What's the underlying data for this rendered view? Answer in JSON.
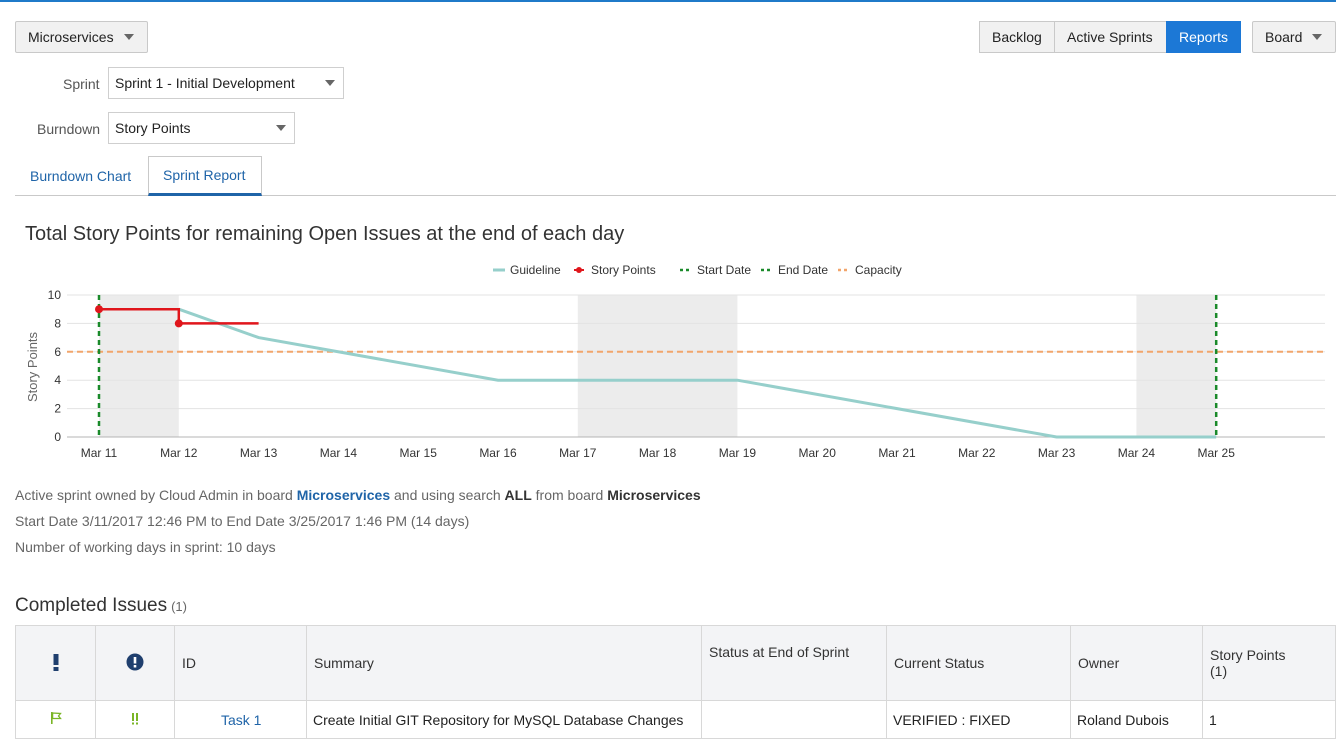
{
  "toolbar": {
    "board_selector": "Microservices",
    "nav": [
      "Backlog",
      "Active Sprints",
      "Reports"
    ],
    "board_menu": "Board"
  },
  "filters": {
    "sprint_label": "Sprint",
    "sprint_value": "Sprint 1 - Initial Development",
    "burndown_label": "Burndown",
    "burndown_value": "Story Points"
  },
  "tabs": [
    "Burndown Chart",
    "Sprint Report"
  ],
  "chart_data": {
    "type": "line",
    "title": "Total Story Points for remaining Open Issues at the end of each day",
    "ylabel": "Story Points",
    "xlabel": "",
    "ylim": [
      0,
      10
    ],
    "yticks": [
      "0",
      "2",
      "4",
      "6",
      "8",
      "10"
    ],
    "categories": [
      "Mar 11",
      "Mar 12",
      "Mar 13",
      "Mar 14",
      "Mar 15",
      "Mar 16",
      "Mar 17",
      "Mar 18",
      "Mar 19",
      "Mar 20",
      "Mar 21",
      "Mar 22",
      "Mar 23",
      "Mar 24",
      "Mar 25"
    ],
    "legend": [
      "Guideline",
      "Story Points",
      "Start Date",
      "End Date",
      "Capacity"
    ],
    "legend_position": "top",
    "grid": true,
    "non_working_ranges": [
      [
        "Mar 11",
        "Mar 12"
      ],
      [
        "Mar 17",
        "Mar 19"
      ],
      [
        "Mar 24",
        "Mar 25"
      ]
    ],
    "series": [
      {
        "name": "Guideline",
        "color": "#96cfcb",
        "x": [
          "Mar 12",
          "Mar 13",
          "Mar 16",
          "Mar 19",
          "Mar 23",
          "Mar 25"
        ],
        "values": [
          9,
          7,
          4,
          4,
          0,
          0
        ]
      },
      {
        "name": "Story Points",
        "color": "#e0161c",
        "x": [
          "Mar 11",
          "Mar 12",
          "Mar 12",
          "Mar 13"
        ],
        "values": [
          9,
          9,
          8,
          8
        ]
      }
    ],
    "start_date": "Mar 11",
    "end_date": "Mar 25",
    "capacity": 6,
    "colors": {
      "start_end": "#1a8a2a",
      "capacity": "#f2a56b",
      "shade": "#ececec"
    }
  },
  "info": {
    "l1_a": "Active sprint owned by Cloud Admin in board ",
    "l1_board": "Microservices",
    "l1_b": " and using search ",
    "l1_search": "ALL",
    "l1_c": " from board ",
    "l1_board2": "Microservices",
    "line2": "Start Date 3/11/2017 12:46 PM to End Date 3/25/2017 1:46 PM (14 days)",
    "line3": "Number of working days in sprint: 10 days"
  },
  "completed": {
    "title": "Completed Issues",
    "count": "(1)",
    "headers": [
      "ID",
      "Summary",
      "Status at End of Sprint",
      "Current Status",
      "Owner",
      "Story Points",
      "(1)"
    ],
    "rows": [
      {
        "id": "Task 1",
        "summary": "Create Initial GIT Repository for MySQL Database Changes",
        "status_end": "",
        "current_status": "VERIFIED : FIXED",
        "owner": "Roland Dubois",
        "points": "1"
      }
    ]
  }
}
